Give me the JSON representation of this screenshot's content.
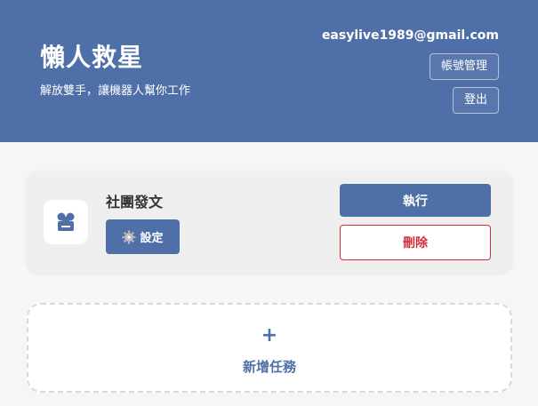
{
  "header": {
    "title": "懶人救星",
    "subtitle": "解放雙手，讓機器人幫你工作",
    "user_email": "easylive1989@gmail.com",
    "account_button": "帳號管理",
    "logout_button": "登出"
  },
  "tasks": [
    {
      "name": "社團發文",
      "icon": "robot-icon",
      "settings_label": "設定",
      "settings_icon": "gear-icon",
      "run_label": "執行",
      "delete_label": "刪除"
    }
  ],
  "add_task": {
    "plus": "+",
    "label": "新增任務"
  },
  "colors": {
    "brand": "#4f6fa8",
    "danger": "#d32f3f",
    "background": "#f5f6f8",
    "card": "#efefef"
  }
}
